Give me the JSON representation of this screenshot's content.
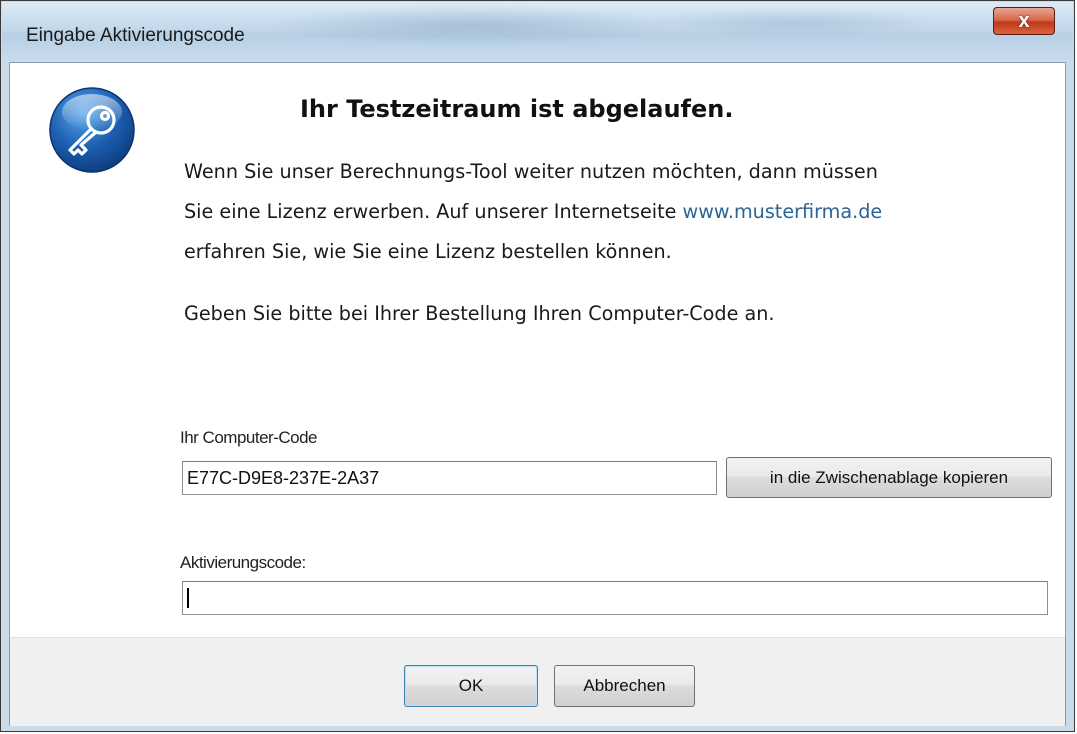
{
  "window": {
    "title": "Eingabe Aktivierungscode",
    "close_glyph": "x"
  },
  "content": {
    "headline": "Ihr Testzeitraum ist abgelaufen.",
    "para1_line1": "Wenn Sie unser Berechnungs-Tool weiter nutzen möchten, dann müssen",
    "para1_line2_prefix": "Sie eine Lizenz erwerben. Auf unserer Internetseite ",
    "para1_link": "www.musterfirma.de",
    "para1_line3": "erfahren Sie, wie Sie eine Lizenz bestellen können.",
    "para2": "Geben Sie bitte bei Ihrer Bestellung Ihren Computer-Code an."
  },
  "computer_code": {
    "label": "Ihr Computer-Code",
    "value": "E77C-D9E8-237E-2A37",
    "copy_button": "in die Zwischenablage kopieren"
  },
  "activation": {
    "label": "Aktivierungscode:",
    "value": ""
  },
  "footer": {
    "ok_label": "OK",
    "cancel_label": "Abbrechen"
  },
  "icons": {
    "app_icon": "key-icon",
    "close": "close-icon"
  },
  "colors": {
    "link": "#2a6496",
    "icon_blue": "#1c5fb0"
  }
}
